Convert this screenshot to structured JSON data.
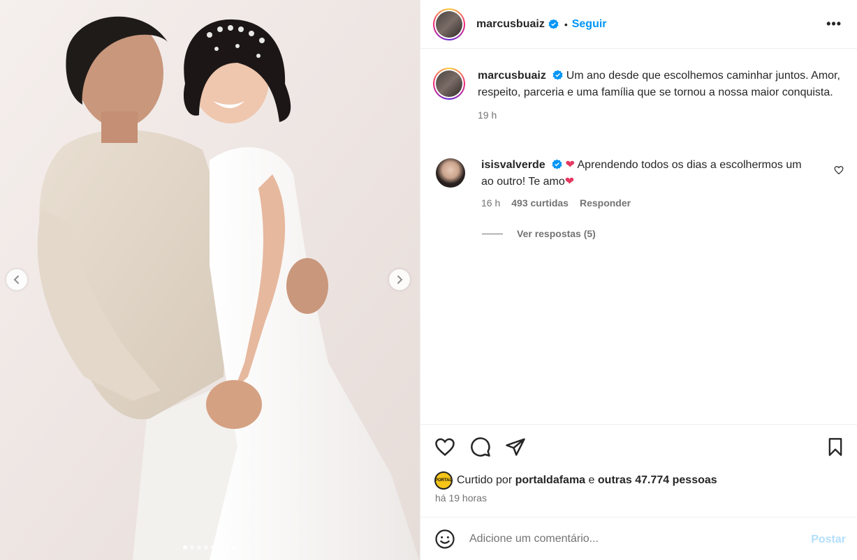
{
  "post": {
    "author": "marcusbuaiz",
    "follow_label": "Seguir",
    "separator": "•",
    "more_label": "•••"
  },
  "caption": {
    "author": "marcusbuaiz",
    "text": "Um ano desde que escolhemos caminhar juntos. Amor, respeito, parceria e uma família que se tornou a nossa maior conquista.",
    "time": "19 h"
  },
  "comments": [
    {
      "author": "isisvalverde",
      "text": "Aprendendo todos os dias a escolhermos um ao outro! Te amo",
      "heart_emoji": "❤",
      "time": "16 h",
      "likes": "493 curtidas",
      "reply_label": "Responder",
      "view_replies": "Ver respostas (5)"
    }
  ],
  "likes": {
    "prefix": "Curtido por",
    "first_user": "portaldafama",
    "connector": "e",
    "others": "outras 47.774 pessoas",
    "avatar_text": "PORTAL"
  },
  "timestamp": "há 19 horas",
  "add_comment": {
    "placeholder": "Adicione um comentário...",
    "post_label": "Postar"
  },
  "carousel": {
    "total_slides": 8,
    "active_slide": 1
  },
  "colors": {
    "accent": "#0095f6",
    "verified": "#0095f6",
    "heart": "#e63860",
    "muted": "#737373"
  }
}
